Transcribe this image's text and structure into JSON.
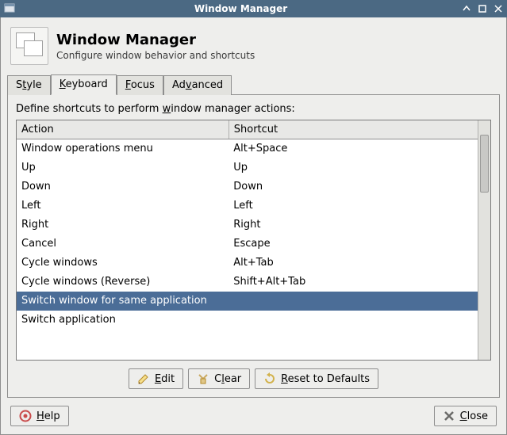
{
  "window": {
    "title": "Window Manager"
  },
  "header": {
    "title": "Window Manager",
    "subtitle": "Configure window behavior and shortcuts"
  },
  "tabs": [
    {
      "pre": "S",
      "accel": "t",
      "post": "yle",
      "active": false
    },
    {
      "pre": "",
      "accel": "K",
      "post": "eyboard",
      "active": true
    },
    {
      "pre": "",
      "accel": "F",
      "post": "ocus",
      "active": false
    },
    {
      "pre": "Ad",
      "accel": "v",
      "post": "anced",
      "active": false
    }
  ],
  "instruct": {
    "pre": "Define shortcuts to perform ",
    "accel": "w",
    "post": "indow manager actions:"
  },
  "columns": {
    "action": "Action",
    "shortcut": "Shortcut"
  },
  "rows": [
    {
      "action": "Window operations menu",
      "shortcut": "Alt+Space",
      "selected": false
    },
    {
      "action": "Up",
      "shortcut": "Up",
      "selected": false
    },
    {
      "action": "Down",
      "shortcut": "Down",
      "selected": false
    },
    {
      "action": "Left",
      "shortcut": "Left",
      "selected": false
    },
    {
      "action": "Right",
      "shortcut": "Right",
      "selected": false
    },
    {
      "action": "Cancel",
      "shortcut": "Escape",
      "selected": false
    },
    {
      "action": "Cycle windows",
      "shortcut": "Alt+Tab",
      "selected": false
    },
    {
      "action": "Cycle windows (Reverse)",
      "shortcut": "Shift+Alt+Tab",
      "selected": false
    },
    {
      "action": "Switch window for same application",
      "shortcut": "",
      "selected": true
    },
    {
      "action": "Switch application",
      "shortcut": "",
      "selected": false
    }
  ],
  "buttons": {
    "edit": {
      "accel": "E",
      "post": "dit"
    },
    "clear": {
      "pre": "C",
      "accel": "l",
      "post": "ear"
    },
    "reset": {
      "accel": "R",
      "post": "eset to Defaults"
    },
    "help": {
      "accel": "H",
      "post": "elp"
    },
    "close": {
      "accel": "C",
      "post": "lose"
    }
  }
}
